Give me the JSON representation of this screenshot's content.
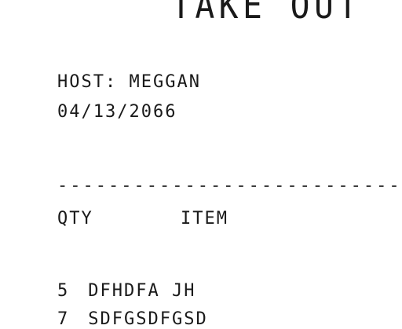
{
  "receipt": {
    "title": "TAKE OUT",
    "host": "HOST: MEGGAN",
    "date": "04/13/2066",
    "divider": "----------------------------",
    "columns": {
      "qty": "QTY",
      "item": "ITEM"
    },
    "items": [
      {
        "qty": "5",
        "name": "DFHDFA JH"
      },
      {
        "qty": "7",
        "name": "SDFGSDFGSD"
      }
    ]
  }
}
